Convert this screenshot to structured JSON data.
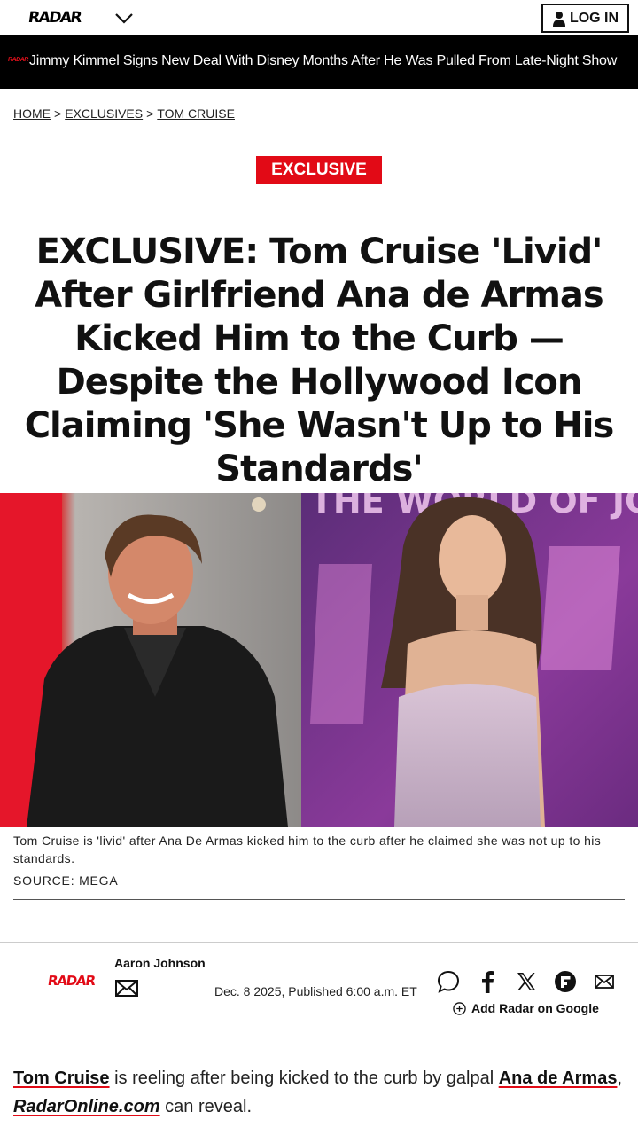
{
  "header": {
    "logo": "RADAR",
    "menu_icon": "chevron-down-icon",
    "login_label": "LOG IN",
    "login_icon": "user-icon"
  },
  "ticker": {
    "logo": "RADAR",
    "text": "Jimmy Kimmel Signs New Deal With Disney Months After He Was Pulled From Late-Night Show"
  },
  "breadcrumb": {
    "items": [
      "HOME",
      "EXCLUSIVES",
      "TOM CRUISE"
    ],
    "separator": ">"
  },
  "article": {
    "badge": "EXCLUSIVE",
    "headline": "EXCLUSIVE: Tom Cruise 'Livid' After Girlfriend Ana de Armas Kicked Him to the Curb — Despite the Hollywood Icon Claiming 'She Wasn't Up to His Standards'",
    "hero_bg_text": "THE WORLD OF JOHN",
    "caption": "Tom Cruise is 'livid' after Ana De Armas kicked him to the curb after he claimed she was not up to his standards.",
    "source": "SOURCE: MEGA",
    "author": {
      "logo": "RADAR",
      "name": "Aaron Johnson",
      "mail_icon": "envelope-icon"
    },
    "published": "Dec. 8 2025, Published 6:00 a.m. ET",
    "share_icons": [
      "comment-icon",
      "facebook-icon",
      "x-icon",
      "flipboard-icon",
      "email-icon"
    ],
    "add_google": "Add Radar on Google",
    "body": {
      "link1": "Tom Cruise",
      "text1": " is reeling after being kicked to the curb by galpal ",
      "link2": "Ana de Armas",
      "text2": ",",
      "link3": "RadarOnline.com",
      "text3": " can reveal."
    }
  },
  "colors": {
    "accent_red": "#e20a16",
    "ticker_bg": "#000000",
    "text": "#111111"
  }
}
